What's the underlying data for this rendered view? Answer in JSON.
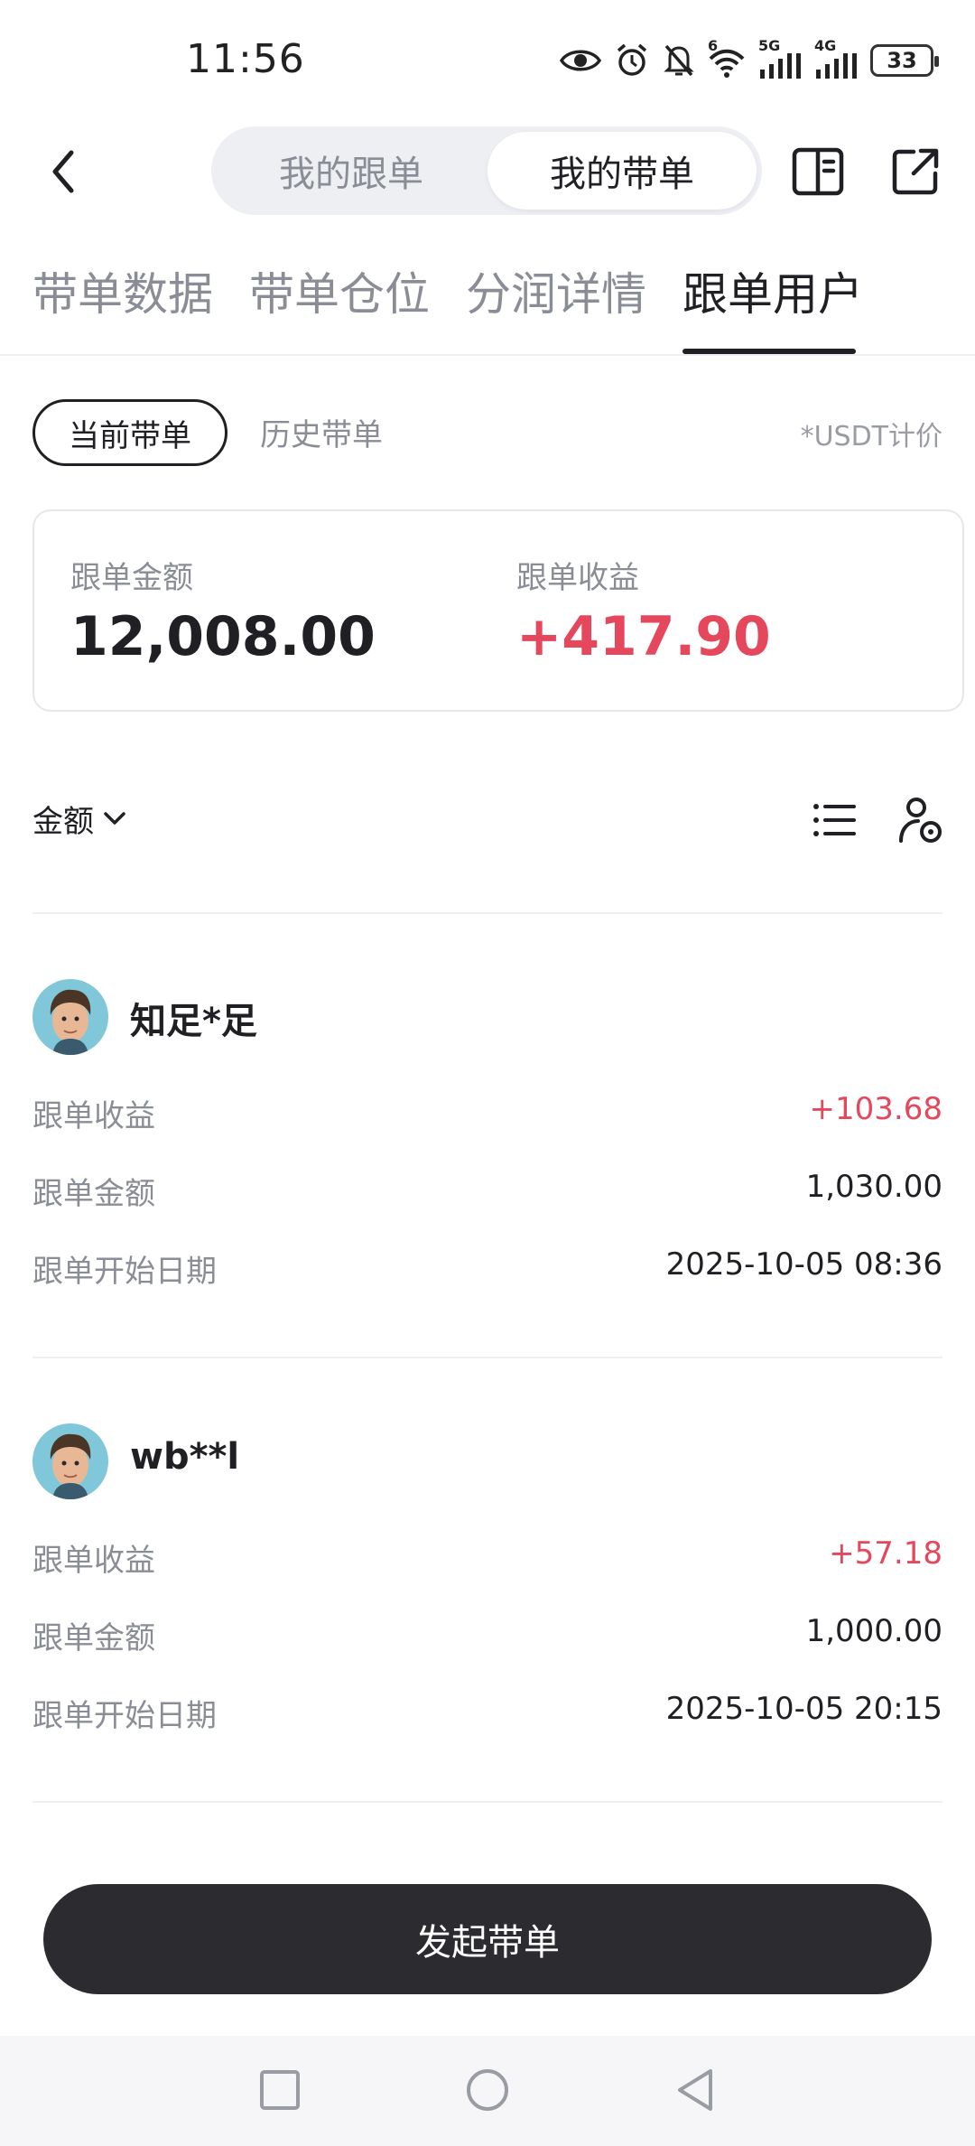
{
  "status_bar": {
    "time": "11:56",
    "network_5g": "5G",
    "network_4g": "4G",
    "wifi_badge": "6",
    "battery": "33",
    "icons": [
      "eye-icon",
      "alarm-icon",
      "mute-icon",
      "wifi-icon",
      "signal-icon",
      "signal-icon",
      "battery-icon"
    ]
  },
  "header": {
    "toggle": [
      "我的跟单",
      "我的带单"
    ],
    "active_toggle": "我的带单",
    "icons": [
      "back-icon",
      "book-icon",
      "share-icon"
    ]
  },
  "tabs": [
    "带单数据",
    "带单仓位",
    "分润详情",
    "跟单用户"
  ],
  "active_tab": "跟单用户",
  "subtabs": {
    "current": "当前带单",
    "history": "历史带单",
    "note": "*USDT计价"
  },
  "summary": {
    "amount_label": "跟单金额",
    "amount_value": "12,008.00",
    "profit_label": "跟单收益",
    "profit_value": "+417.90"
  },
  "toolbar": {
    "sort_label": "金额",
    "icons": [
      "list-icon",
      "user-settings-icon"
    ]
  },
  "followers": [
    {
      "name": "知足*足",
      "profit_label": "跟单收益",
      "profit": "+103.68",
      "amount_label": "跟单金额",
      "amount": "1,030.00",
      "date_label": "跟单开始日期",
      "date": "2025-10-05 08:36"
    },
    {
      "name": "wb**l",
      "profit_label": "跟单收益",
      "profit": "+57.18",
      "amount_label": "跟单金额",
      "amount": "1,000.00",
      "date_label": "跟单开始日期",
      "date": "2025-10-05 20:15"
    }
  ],
  "cta_label": "发起带单",
  "colors": {
    "profit_red": "#e5475d",
    "dark_button": "#2b2b30",
    "muted_text": "#8a8d95"
  }
}
